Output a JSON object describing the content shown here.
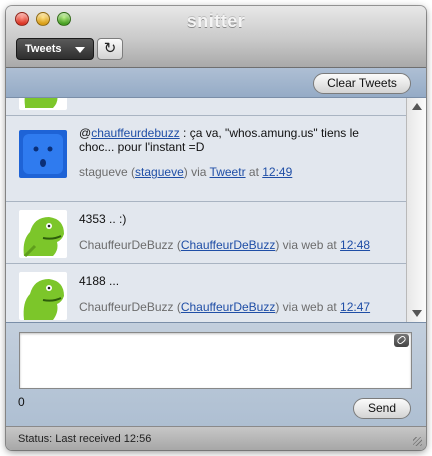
{
  "window": {
    "title": "snitter"
  },
  "toolbar": {
    "view_select": "Tweets",
    "refresh_icon": "refresh-icon"
  },
  "header": {
    "clear_label": "Clear Tweets"
  },
  "tweets": [
    {
      "avatar": "green-monster",
      "text_prefix": "",
      "mention": "",
      "text": "",
      "author": "",
      "handle": "",
      "via_label": "",
      "client": "",
      "at_label": "",
      "time": ""
    },
    {
      "avatar": "blue-face",
      "text_prefix": "@",
      "mention": "chauffeurdebuzz",
      "text": " : ça va, \"whos.amung.us\" tiens le choc... pour l'instant =D",
      "author": "stagueve",
      "handle": "stagueve",
      "via_label": " via ",
      "client": "Tweetr",
      "at_label": " at ",
      "time": "12:49"
    },
    {
      "avatar": "green-monster",
      "text_prefix": "",
      "mention": "",
      "text": "4353 .. :)",
      "author": "ChauffeurDeBuzz",
      "handle": "ChauffeurDeBuzz",
      "via_label": " via web at ",
      "client": "",
      "at_label": "",
      "time": "12:48"
    },
    {
      "avatar": "green-monster",
      "text_prefix": "",
      "mention": "",
      "text": "4188 ...",
      "author": "ChauffeurDeBuzz",
      "handle": "ChauffeurDeBuzz",
      "via_label": " via web at ",
      "client": "",
      "at_label": "",
      "time": "12:47"
    }
  ],
  "composer": {
    "input_value": "",
    "char_count": "0",
    "send_label": "Send"
  },
  "status": {
    "text": "Status: Last received 12:56"
  },
  "colors": {
    "link": "#1f4ea6",
    "header_bar": "#95abc6",
    "list_bg": "#e2e7ee"
  }
}
